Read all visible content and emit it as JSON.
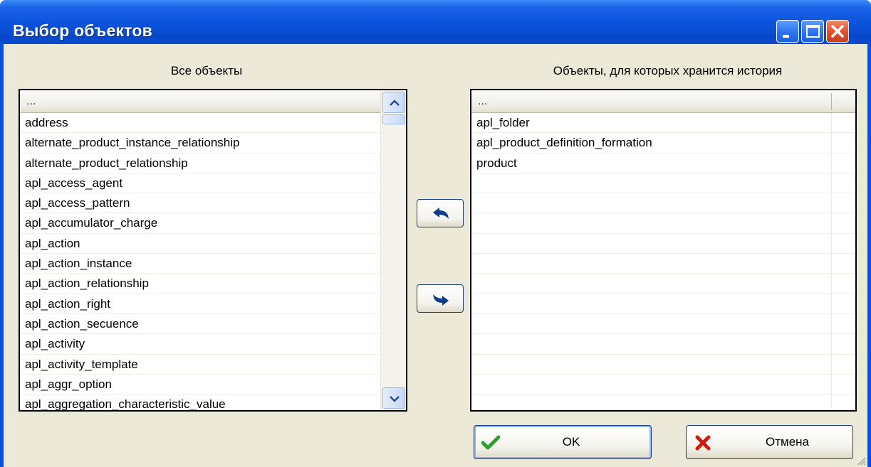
{
  "window": {
    "title": "Выбор объектов"
  },
  "left_panel": {
    "heading": "Все объекты",
    "column_header": "...",
    "items": [
      "address",
      "alternate_product_instance_relationship",
      "alternate_product_relationship",
      "apl_access_agent",
      "apl_access_pattern",
      "apl_accumulator_charge",
      "apl_action",
      "apl_action_instance",
      "apl_action_relationship",
      "apl_action_right",
      "apl_action_secuence",
      "apl_activity",
      "apl_activity_template",
      "apl_aggr_option",
      "apl_aggregation_characteristic_value"
    ]
  },
  "right_panel": {
    "heading": "Объекты, для которых хранится история",
    "column_header": "...",
    "items": [
      "apl_folder",
      "apl_product_definition_formation",
      "product",
      "",
      "",
      "",
      "",
      "",
      "",
      "",
      "",
      "",
      "",
      "",
      ""
    ]
  },
  "buttons": {
    "ok_label": "OK",
    "cancel_label": "Отмена"
  },
  "colors": {
    "title_bar": "#0a52dc",
    "dialog_bg": "#ece9d8",
    "ok_check": "#2aa12a",
    "cancel_x": "#d11a0c",
    "arrow_blue": "#0e3d8c"
  }
}
